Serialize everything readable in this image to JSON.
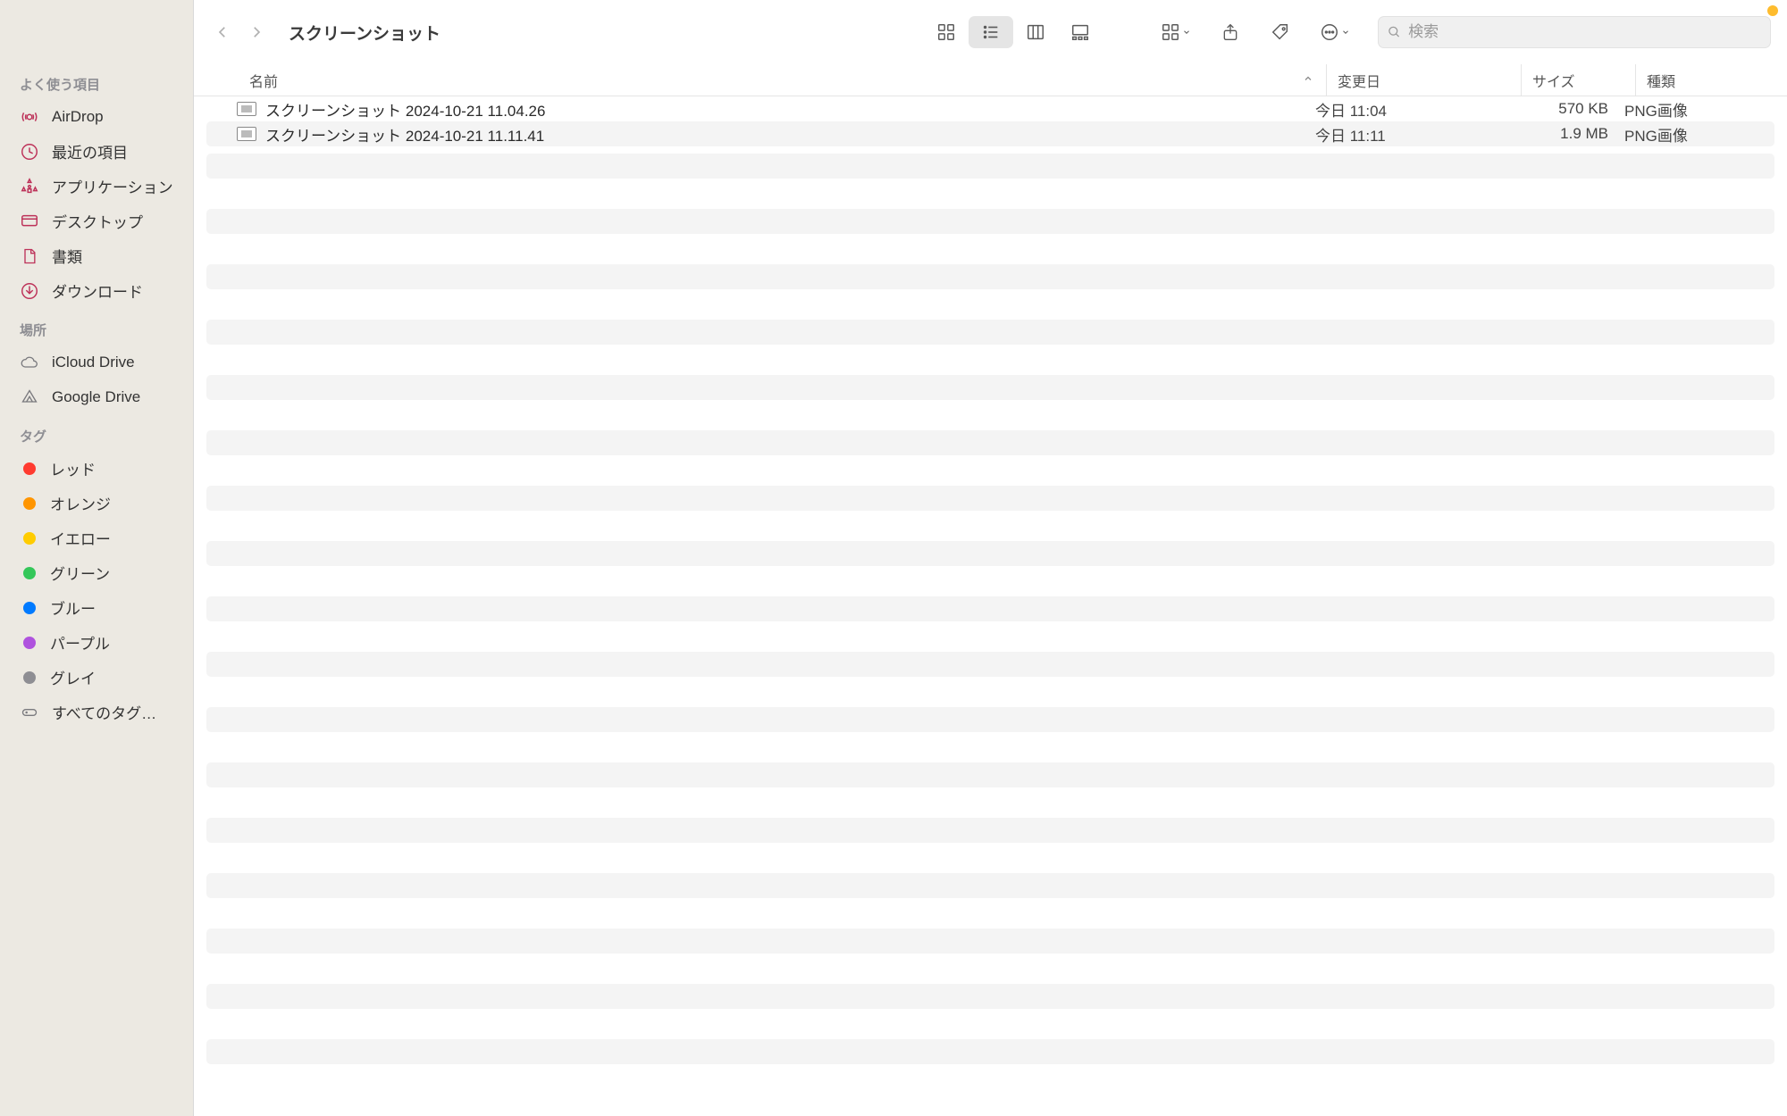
{
  "window": {
    "title": "スクリーンショット"
  },
  "search": {
    "placeholder": "検索"
  },
  "sidebar": {
    "favorites_title": "よく使う項目",
    "favorites": [
      {
        "label": "AirDrop",
        "icon": "airdrop"
      },
      {
        "label": "最近の項目",
        "icon": "clock"
      },
      {
        "label": "アプリケーション",
        "icon": "apps"
      },
      {
        "label": "デスクトップ",
        "icon": "desktop"
      },
      {
        "label": "書類",
        "icon": "doc"
      },
      {
        "label": "ダウンロード",
        "icon": "download"
      }
    ],
    "locations_title": "場所",
    "locations": [
      {
        "label": "iCloud Drive",
        "icon": "cloud"
      },
      {
        "label": "Google Drive",
        "icon": "gdrive"
      }
    ],
    "tags_title": "タグ",
    "tags": [
      {
        "label": "レッド",
        "color": "#ff3b30"
      },
      {
        "label": "オレンジ",
        "color": "#ff9500"
      },
      {
        "label": "イエロー",
        "color": "#ffcc00"
      },
      {
        "label": "グリーン",
        "color": "#34c759"
      },
      {
        "label": "ブルー",
        "color": "#007aff"
      },
      {
        "label": "パープル",
        "color": "#af52de"
      },
      {
        "label": "グレイ",
        "color": "#8e8e93"
      }
    ],
    "all_tags_label": "すべてのタグ…"
  },
  "columns": {
    "name": "名前",
    "modified": "変更日",
    "size": "サイズ",
    "kind": "種類"
  },
  "files": [
    {
      "name": "スクリーンショット 2024-10-21 11.04.26",
      "modified": "今日 11:04",
      "size": "570 KB",
      "kind": "PNG画像"
    },
    {
      "name": "スクリーンショット 2024-10-21 11.11.41",
      "modified": "今日 11:11",
      "size": "1.9 MB",
      "kind": "PNG画像"
    }
  ]
}
